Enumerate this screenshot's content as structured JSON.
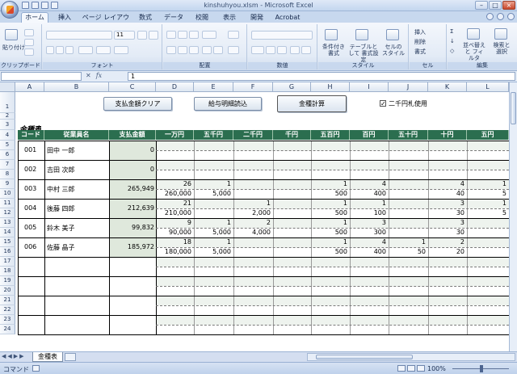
{
  "window": {
    "title": "kinshuhyou.xlsm - Microsoft Excel"
  },
  "tabs": [
    "ホーム",
    "挿入",
    "ページ レイアウト",
    "数式",
    "データ",
    "校閲",
    "表示",
    "開発",
    "Acrobat"
  ],
  "ribbon": {
    "clipboard": {
      "paste": "貼り付け",
      "label": "クリップボード"
    },
    "font": {
      "size": "11",
      "label": "フォント"
    },
    "alignment": {
      "label": "配置"
    },
    "number": {
      "label": "数値"
    },
    "styles": {
      "cond": "条件付き 書式",
      "table": "テーブルとして 書式設定",
      "cell": "セルの スタイル",
      "label": "スタイル"
    },
    "cells": {
      "insert": "挿入",
      "delete": "削除",
      "format": "書式",
      "label": "セル"
    },
    "editing": {
      "sort": "並べ替えと フィルタ",
      "find": "検索と 選択",
      "label": "編集"
    }
  },
  "formula": {
    "value": "1"
  },
  "grid": {
    "columns": [
      "A",
      "B",
      "C",
      "D",
      "E",
      "F",
      "G",
      "H",
      "I",
      "J",
      "K",
      "L"
    ],
    "rows": [
      "1",
      "2",
      "3",
      "4",
      "5",
      "6",
      "7",
      "8",
      "9",
      "10",
      "11",
      "12",
      "13",
      "14",
      "15",
      "16",
      "17",
      "18",
      "19",
      "20",
      "21",
      "22",
      "23",
      "24"
    ],
    "buttons": {
      "clear": "支払金額クリア",
      "load": "給与明細読込",
      "calc": "金種計算"
    },
    "checkbox_label": "二千円札使用",
    "section_title": "金種表",
    "headers": [
      "コード",
      "従業員名",
      "支払金額",
      "一万円",
      "五千円",
      "二千円",
      "千円",
      "五百円",
      "百円",
      "五十円",
      "十円",
      "五円"
    ],
    "employees": [
      {
        "code": "001",
        "name": "田中 一郎",
        "amount": "0",
        "counts": [
          "",
          "",
          "",
          "",
          "",
          "",
          "",
          "",
          ""
        ],
        "values": [
          "",
          "",
          "",
          "",
          "",
          "",
          "",
          "",
          ""
        ]
      },
      {
        "code": "002",
        "name": "吉田 次郎",
        "amount": "0",
        "counts": [
          "",
          "",
          "",
          "",
          "",
          "",
          "",
          "",
          ""
        ],
        "values": [
          "",
          "",
          "",
          "",
          "",
          "",
          "",
          "",
          ""
        ]
      },
      {
        "code": "003",
        "name": "中村 三郎",
        "amount": "265,949",
        "counts": [
          "26",
          "1",
          "",
          "",
          "1",
          "4",
          "",
          "4",
          "1"
        ],
        "values": [
          "260,000",
          "5,000",
          "",
          "",
          "500",
          "400",
          "",
          "40",
          "5"
        ]
      },
      {
        "code": "004",
        "name": "後藤 四郎",
        "amount": "212,639",
        "counts": [
          "21",
          "",
          "1",
          "",
          "1",
          "1",
          "",
          "3",
          "1"
        ],
        "values": [
          "210,000",
          "",
          "2,000",
          "",
          "500",
          "100",
          "",
          "30",
          "5"
        ]
      },
      {
        "code": "005",
        "name": "鈴木 美子",
        "amount": "99,832",
        "counts": [
          "9",
          "1",
          "2",
          "",
          "1",
          "3",
          "",
          "3",
          ""
        ],
        "values": [
          "90,000",
          "5,000",
          "4,000",
          "",
          "500",
          "300",
          "",
          "30",
          ""
        ]
      },
      {
        "code": "006",
        "name": "佐藤 晶子",
        "amount": "185,972",
        "counts": [
          "18",
          "1",
          "",
          "",
          "1",
          "4",
          "1",
          "2",
          ""
        ],
        "values": [
          "180,000",
          "5,000",
          "",
          "",
          "500",
          "400",
          "50",
          "20",
          ""
        ]
      }
    ]
  },
  "sheet_tab": "金種表",
  "status": {
    "mode": "コマンド",
    "zoom": "100%"
  }
}
